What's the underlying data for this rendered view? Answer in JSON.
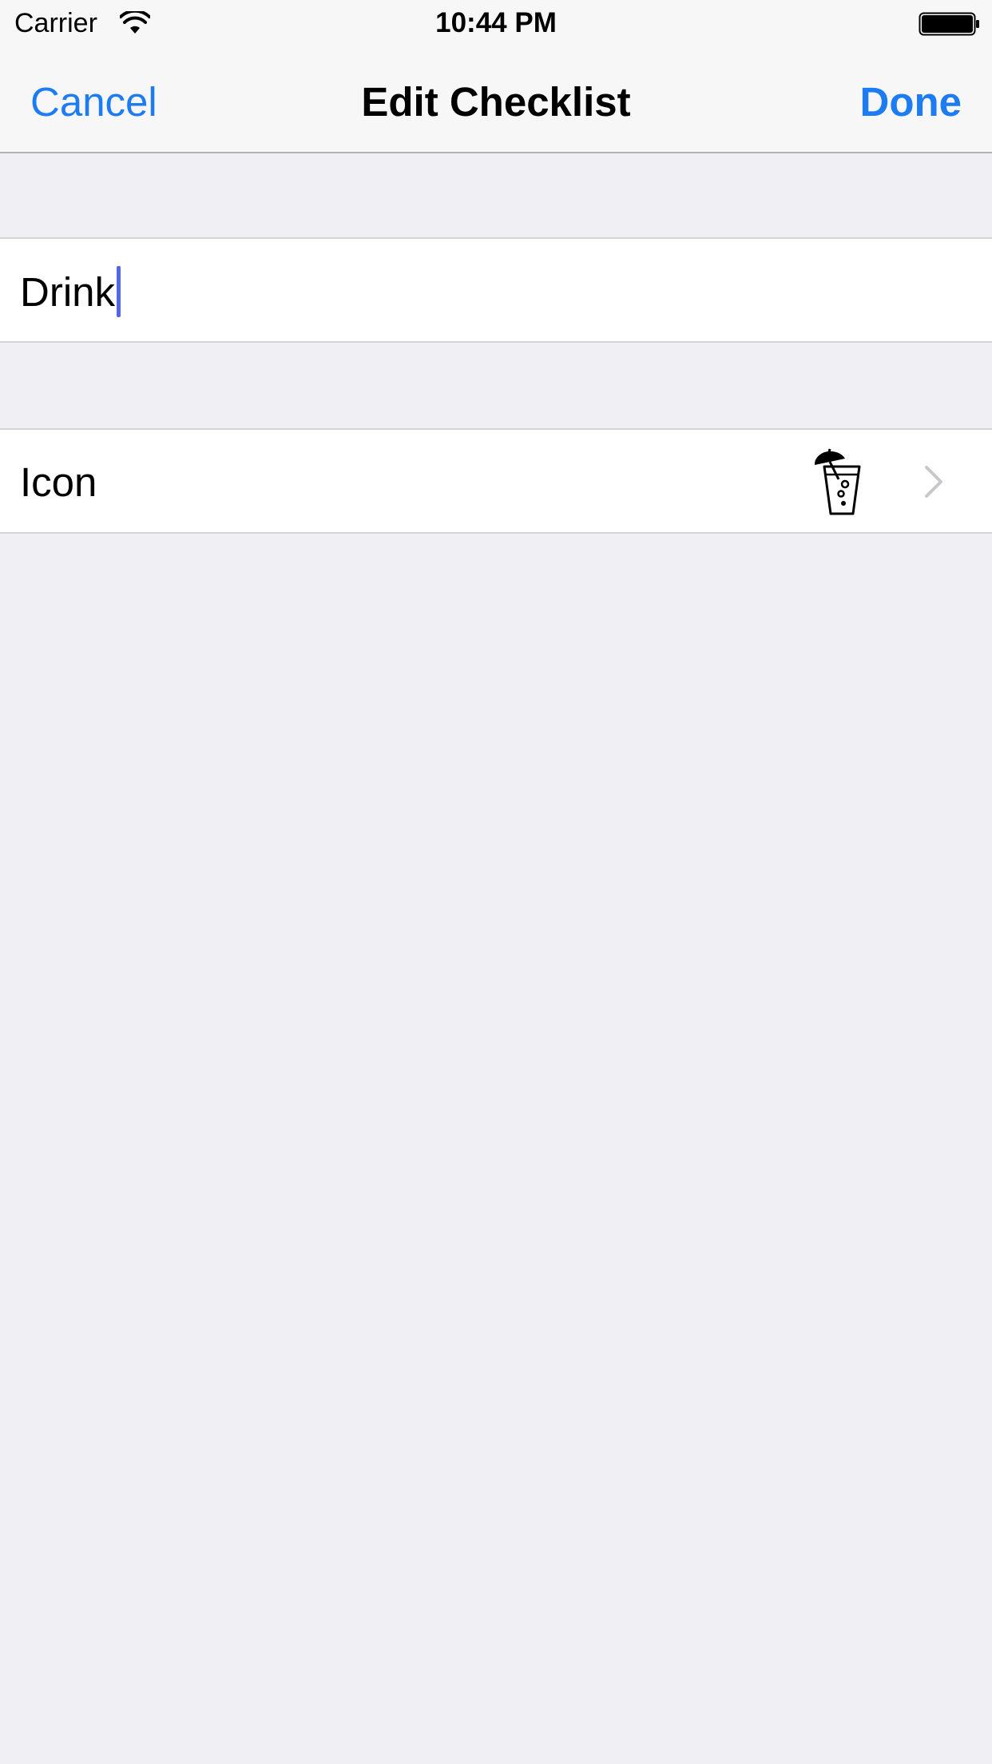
{
  "status_bar": {
    "carrier": "Carrier",
    "time": "10:44 PM"
  },
  "nav": {
    "cancel_label": "Cancel",
    "title": "Edit Checklist",
    "done_label": "Done"
  },
  "form": {
    "name_value": "Drink",
    "icon_label": "Icon",
    "icon_name": "drink-with-umbrella-icon"
  },
  "colors": {
    "accent": "#1d7cf2",
    "background": "#efeff4",
    "caret": "#5167e6"
  }
}
